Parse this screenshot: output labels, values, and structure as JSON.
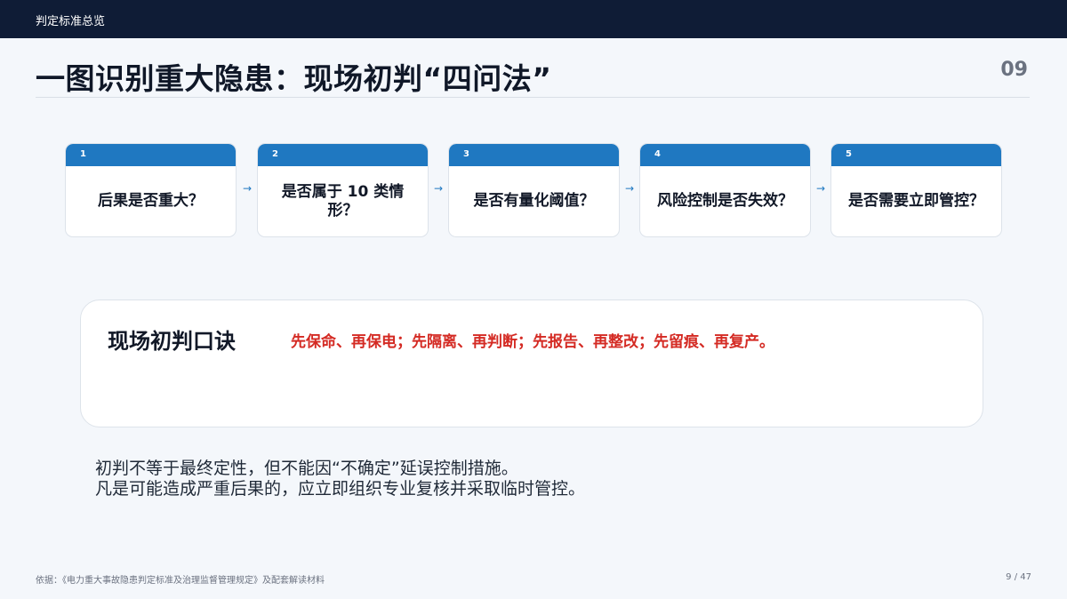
{
  "header": {
    "section_title": "判定标准总览"
  },
  "title": "一图识别重大隐患：现场初判“四问法”",
  "page_number": "09",
  "steps": [
    {
      "num": "1",
      "question": "后果是否重大？"
    },
    {
      "num": "2",
      "question": "是否属于 10 类情形？"
    },
    {
      "num": "3",
      "question": "是否有量化阈值？"
    },
    {
      "num": "4",
      "question": "风险控制是否失效？"
    },
    {
      "num": "5",
      "question": "是否需要立即管控？"
    }
  ],
  "arrow_glyph": "→",
  "mnemonic": {
    "label": "现场初判口诀",
    "text": "先保命、再保电；先隔离、再判断；先报告、再整改；先留痕、再复产。"
  },
  "notes": [
    "初判不等于最终定性，但不能因“不确定”延误控制措施。",
    "凡是可能造成严重后果的，应立即组织专业复核并采取临时管控。"
  ],
  "footer": {
    "source": "依据：《电力重大事故隐患判定标准及治理监督管理规定》及配套解读材料",
    "pagination": "9 / 47"
  },
  "colors": {
    "topbar": "#0f1c36",
    "accent_blue": "#1f78c1",
    "mnemonic_red": "#d42a23"
  }
}
